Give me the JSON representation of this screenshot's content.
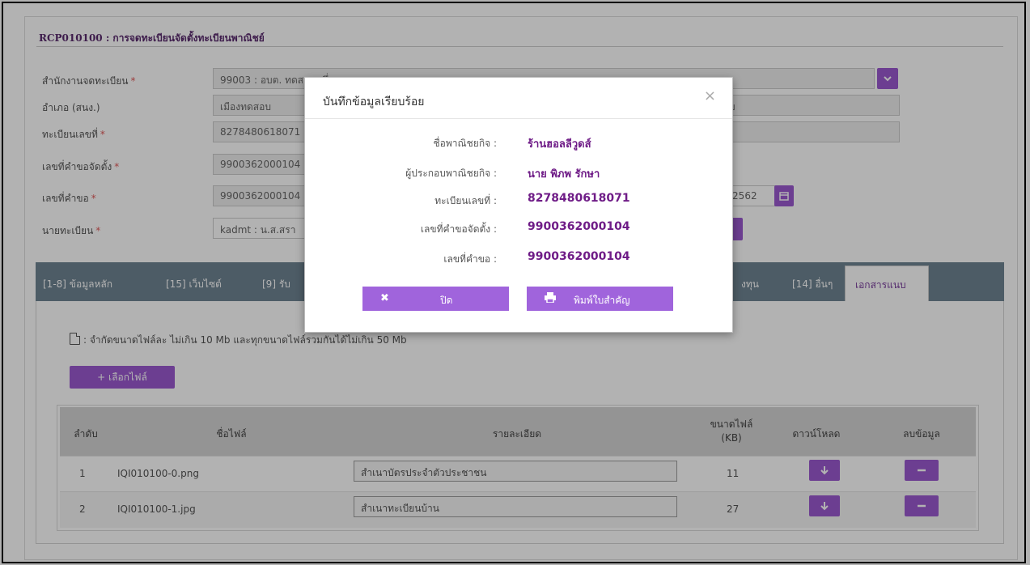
{
  "header": {
    "title": "RCP010100 : การจดทะเบียนจัดตั้งทะเบียนพาณิชย์"
  },
  "form": {
    "office": {
      "label": "สำนักงานจดทะเบียน",
      "value": "99003 : อบต. ทดสอบหนึ่ง"
    },
    "district": {
      "label": "อำเภอ (สนง.)",
      "value": "เมืองทดสอบ",
      "value2": "บ"
    },
    "reg_no": {
      "label": "ทะเบียนเลขที่",
      "value": "8278480618071"
    },
    "request_setup_no": {
      "label": "เลขที่คำขอจัดตั้ง",
      "value": "9900362000104"
    },
    "request_no": {
      "label": "เลขที่คำขอ",
      "value": "9900362000104",
      "date": "/2562"
    },
    "registrar": {
      "label": "นายทะเบียน",
      "value": "kadmt : น.ส.สรา"
    },
    "required_mark": "*"
  },
  "tabs": {
    "items": [
      "[1-8] ข้อมูลหลัก",
      "[15] เว็บไซต์",
      "[9] รับ",
      "งทุน",
      "[14] อื่นๆ"
    ],
    "active": "เอกสารแนบ"
  },
  "attach": {
    "note": ": จำกัดขนาดไฟล์ละ ไม่เกิน 10 Mb และทุกขนาดไฟล์รวมกันได้ไม่เกิน 50 Mb",
    "choose_label": "+  เลือกไฟล์"
  },
  "table": {
    "headers": {
      "seq": "ลำดับ",
      "name": "ชื่อไฟล์",
      "detail": "รายละเอียด",
      "size_l1": "ขนาดไฟล์",
      "size_l2": "(KB)",
      "download": "ดาวน์โหลด",
      "delete": "ลบข้อมูล"
    },
    "rows": [
      {
        "seq": "1",
        "name": "IQI010100-0.png",
        "detail": "สำเนาบัตรประจำตัวประชาชน",
        "size": "11"
      },
      {
        "seq": "2",
        "name": "IQI010100-1.jpg",
        "detail": "สำเนาทะเบียนบ้าน",
        "size": "27"
      }
    ]
  },
  "modal": {
    "title": "บันทึกข้อมูลเรียบร้อย",
    "close_symbol": "×",
    "fields": [
      {
        "label": "ชื่อพาณิชยกิจ :",
        "value": "ร้านฮอลลีวูดส์"
      },
      {
        "label": "ผู้ประกอบพาณิชยกิจ :",
        "value": "นาย พิภพ รักษา"
      },
      {
        "label": "ทะเบียนเลขที่ :",
        "value": "8278480618071"
      },
      {
        "label": "เลขที่คำขอจัดตั้ง :",
        "value": "9900362000104"
      },
      {
        "label": "เลขที่คำขอ :",
        "value": "9900362000104"
      }
    ],
    "close_button": "ปิด",
    "print_button": "พิมพ์ใบสำคัญ"
  },
  "colors": {
    "accent": "#9b59d0",
    "title": "#5a2a6e",
    "tabbar": "#6f8492",
    "modal_value": "#6f1c87"
  }
}
